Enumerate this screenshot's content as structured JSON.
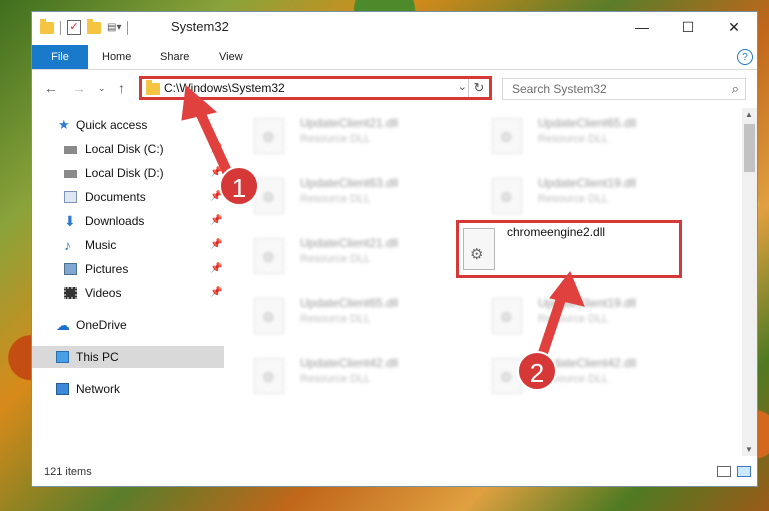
{
  "window": {
    "title": "System32"
  },
  "ribbon": {
    "tabs": [
      "File",
      "Home",
      "Share",
      "View"
    ]
  },
  "address": {
    "path": "C:\\Windows\\System32"
  },
  "search": {
    "placeholder": "Search System32"
  },
  "sidebar": {
    "items": [
      {
        "label": "Quick access",
        "icon": "star-icon"
      },
      {
        "label": "Local Disk (C:)",
        "icon": "drive-icon"
      },
      {
        "label": "Local Disk (D:)",
        "icon": "drive-icon"
      },
      {
        "label": "Documents",
        "icon": "documents-icon"
      },
      {
        "label": "Downloads",
        "icon": "download-icon"
      },
      {
        "label": "Music",
        "icon": "music-icon"
      },
      {
        "label": "Pictures",
        "icon": "pictures-icon"
      },
      {
        "label": "Videos",
        "icon": "videos-icon"
      },
      {
        "label": "OneDrive",
        "icon": "cloud-icon"
      },
      {
        "label": "This PC",
        "icon": "computer-icon"
      },
      {
        "label": "Network",
        "icon": "network-icon"
      }
    ]
  },
  "files": [
    {
      "name": "UpdateClient21.dll",
      "type": "Resource DLL"
    },
    {
      "name": "UpdateClient65.dll",
      "type": "Resource DLL"
    },
    {
      "name": "UpdateClient63.dll",
      "type": "Resource DLL"
    },
    {
      "name": "UpdateClient19.dll",
      "type": "Resource DLL"
    },
    {
      "name": "UpdateClient21.dll",
      "type": "Resource DLL"
    },
    {
      "name": "UpdateClient65.dll",
      "type": "Resource DLL"
    },
    {
      "name": "UpdateClient19.dll",
      "type": "Resource DLL"
    },
    {
      "name": "UpdateClient42.dll",
      "type": "Resource DLL"
    },
    {
      "name": "UpdateClient42.dll",
      "type": "Resource DLL"
    }
  ],
  "highlighted_file": {
    "name": "chromeengine2.dll"
  },
  "status": {
    "items": "121 items"
  },
  "badges": {
    "one": "1",
    "two": "2"
  },
  "colors": {
    "accent": "#1979ca",
    "highlight": "#d63838"
  }
}
